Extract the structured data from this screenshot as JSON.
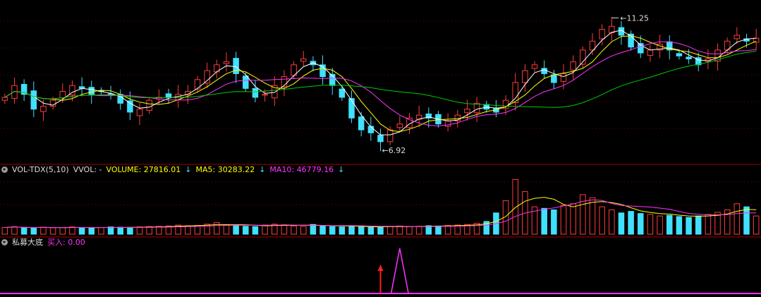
{
  "colors": {
    "up": "#ff3c3c",
    "down": "#40e0ff",
    "ma5": "#ffffff",
    "ma10": "#ffff00",
    "ma20": "#ff33ff",
    "ma60": "#00cc00",
    "volma5": "#ffff00",
    "volma10": "#ff33ff",
    "signal": "#ff33ff",
    "arrow": "#ff2020",
    "grid": "#7a0000"
  },
  "price_panel": {
    "high_label": "11.25",
    "low_label": "6.92"
  },
  "volume_panel": {
    "name": "VOL-TDX(5,10)",
    "vvol": "VVOL: -",
    "volume_label": "VOLUME: 27816.01",
    "ma5_label": "MA5: 30283.22",
    "ma10_label": "MA10: 46779.16",
    "arrow": "↓"
  },
  "indicator_panel": {
    "name": "私募大底",
    "buy_label": "买入: 0.00"
  },
  "chart_data": [
    {
      "type": "candlestick",
      "title": "",
      "ylim": [
        6.4,
        11.6
      ],
      "high": 11.25,
      "low": 6.92,
      "close_series": [
        8.5,
        8.9,
        8.6,
        8.1,
        8.2,
        8.4,
        8.7,
        8.9,
        8.8,
        8.6,
        8.7,
        8.6,
        8.3,
        8.0,
        8.1,
        8.4,
        8.5,
        8.5,
        8.6,
        8.7,
        9.1,
        9.4,
        9.6,
        9.7,
        9.3,
        8.8,
        8.5,
        8.6,
        8.9,
        9.2,
        9.6,
        9.8,
        9.6,
        9.2,
        8.9,
        8.5,
        7.8,
        7.4,
        7.3,
        7.0,
        7.4,
        7.6,
        7.8,
        7.9,
        7.8,
        7.6,
        7.7,
        7.9,
        8.1,
        8.3,
        8.1,
        8.0,
        8.4,
        9.0,
        9.4,
        9.6,
        9.3,
        9.0,
        9.3,
        9.7,
        10.1,
        10.4,
        10.8,
        10.9,
        10.6,
        10.2,
        10.0,
        10.1,
        10.3,
        10.1,
        9.9,
        9.8,
        9.6,
        9.8,
        10.1,
        10.4,
        10.6,
        10.4,
        10.5
      ],
      "ma_series": [
        "MA5",
        "MA10",
        "MA20",
        "MA60"
      ]
    },
    {
      "type": "bar",
      "title": "VOL-TDX(5,10)",
      "ylim": [
        0,
        190000
      ],
      "values": [
        22000,
        25000,
        21000,
        20000,
        23000,
        21000,
        22000,
        24000,
        20000,
        21000,
        22000,
        24000,
        23000,
        22000,
        24000,
        25000,
        26000,
        27000,
        30000,
        28000,
        29000,
        33000,
        38000,
        30000,
        28000,
        26000,
        25000,
        30000,
        33000,
        31000,
        27000,
        26000,
        32000,
        29000,
        25000,
        24000,
        26000,
        25000,
        23000,
        24000,
        26000,
        27000,
        25000,
        26000,
        28000,
        27000,
        29000,
        30000,
        32000,
        36000,
        42000,
        70000,
        110000,
        180000,
        140000,
        90000,
        85000,
        80000,
        95000,
        100000,
        130000,
        120000,
        90000,
        80000,
        70000,
        75000,
        68000,
        65000,
        60000,
        62000,
        58000,
        55000,
        60000,
        65000,
        72000,
        80000,
        100000,
        90000,
        60000
      ]
    },
    {
      "type": "line",
      "title": "私募大底",
      "ylim": [
        0,
        1
      ],
      "signal_index": 41,
      "arrow_index": 39,
      "signal_value": 1
    }
  ]
}
